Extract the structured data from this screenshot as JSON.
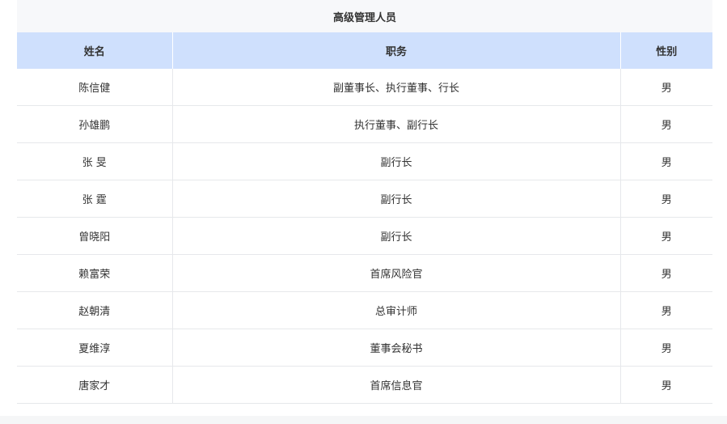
{
  "table": {
    "caption": "高级管理人员",
    "headers": {
      "name": "姓名",
      "title": "职务",
      "gender": "性别"
    },
    "rows": [
      {
        "name": "陈信健",
        "title": "副董事长、执行董事、行长",
        "gender": "男"
      },
      {
        "name": "孙雄鹏",
        "title": "执行董事、副行长",
        "gender": "男"
      },
      {
        "name": "张 旻",
        "title": "副行长",
        "gender": "男"
      },
      {
        "name": "张 霆",
        "title": "副行长",
        "gender": "男"
      },
      {
        "name": "曾晓阳",
        "title": "副行长",
        "gender": "男"
      },
      {
        "name": "赖富荣",
        "title": "首席风险官",
        "gender": "男"
      },
      {
        "name": "赵朝清",
        "title": "总审计师",
        "gender": "男"
      },
      {
        "name": "夏维淳",
        "title": "董事会秘书",
        "gender": "男"
      },
      {
        "name": "唐家才",
        "title": "首席信息官",
        "gender": "男"
      }
    ]
  }
}
